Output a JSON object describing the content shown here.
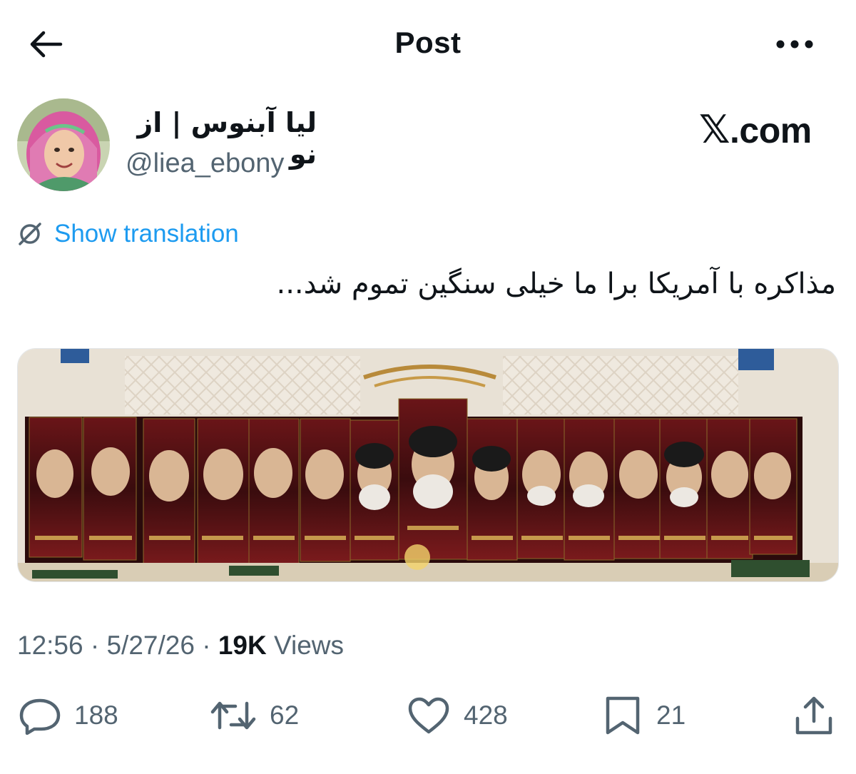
{
  "header": {
    "title": "Post"
  },
  "author": {
    "display_name": "لیا آبنوس | از نو",
    "handle": "@liea_ebony"
  },
  "watermark": {
    "x": "𝕏",
    "text": ".com"
  },
  "translate": {
    "label": "Show translation"
  },
  "tweet": {
    "text": "مذاکره با آمریکا برا ما خیلی سنگین تموم شد..."
  },
  "media": {
    "description": "photo"
  },
  "meta": {
    "time": "12:56",
    "date": "5/27/26",
    "views_count": "19K",
    "views_label": "Views",
    "sep": "·"
  },
  "actions": {
    "replies": "188",
    "reposts": "62",
    "likes": "428",
    "bookmarks": "21"
  },
  "colors": {
    "accent": "#1d9bf0",
    "secondary_text": "#536471",
    "primary_text": "#0f1419"
  }
}
